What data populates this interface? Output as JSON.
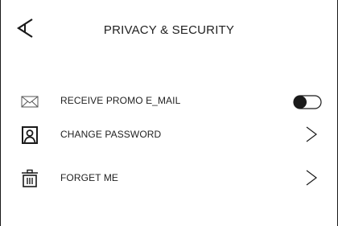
{
  "header": {
    "title": "PRIVACY & SECURITY",
    "back_icon": "chevron-left-icon"
  },
  "settings": {
    "items": [
      {
        "label": "RECEIVE PROMO E_MAIL",
        "icon": "envelope-icon",
        "control": "toggle",
        "toggle_on": false
      },
      {
        "label": "CHANGE PASSWORD",
        "icon": "user-lock-icon",
        "control": "chevron"
      },
      {
        "label": "FORGET ME",
        "icon": "trash-icon",
        "control": "chevron"
      }
    ]
  },
  "colors": {
    "stroke": "#1a1a1a",
    "text": "#222222",
    "background": "#ffffff"
  }
}
